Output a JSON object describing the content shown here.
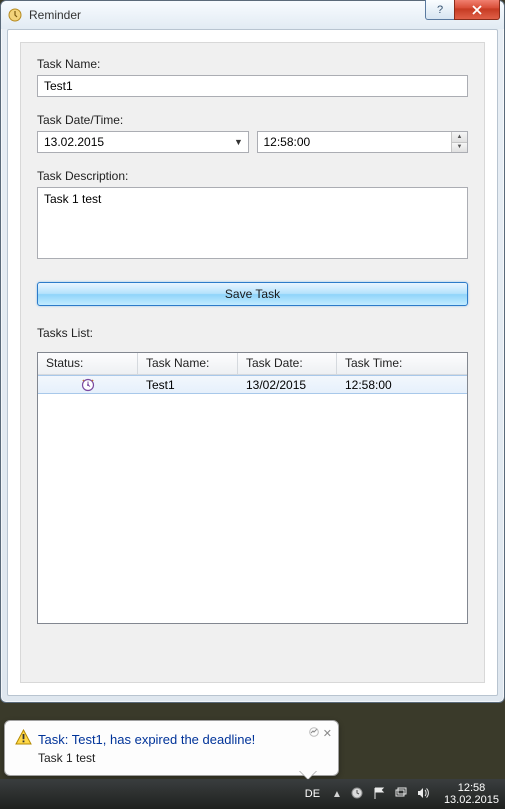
{
  "window": {
    "title": "Reminder"
  },
  "form": {
    "task_name_label": "Task Name:",
    "task_name_value": "Test1",
    "task_datetime_label": "Task Date/Time:",
    "task_date_value": "13.02.2015",
    "task_time_value": "12:58:00",
    "task_desc_label": "Task Description:",
    "task_desc_value": "Task 1 test",
    "save_button_label": "Save Task",
    "tasks_list_label": "Tasks List:"
  },
  "list": {
    "headers": {
      "status": "Status:",
      "name": "Task Name:",
      "date": "Task Date:",
      "time": "Task Time:"
    },
    "rows": [
      {
        "status_icon": "clock-icon",
        "name": "Test1",
        "date": "13/02/2015",
        "time": "12:58:00"
      }
    ]
  },
  "balloon": {
    "title": "Task: Test1, has expired the deadline!",
    "body": "Task 1 test"
  },
  "taskbar": {
    "lang": "DE",
    "time": "12:58",
    "date": "13.02.2015"
  }
}
